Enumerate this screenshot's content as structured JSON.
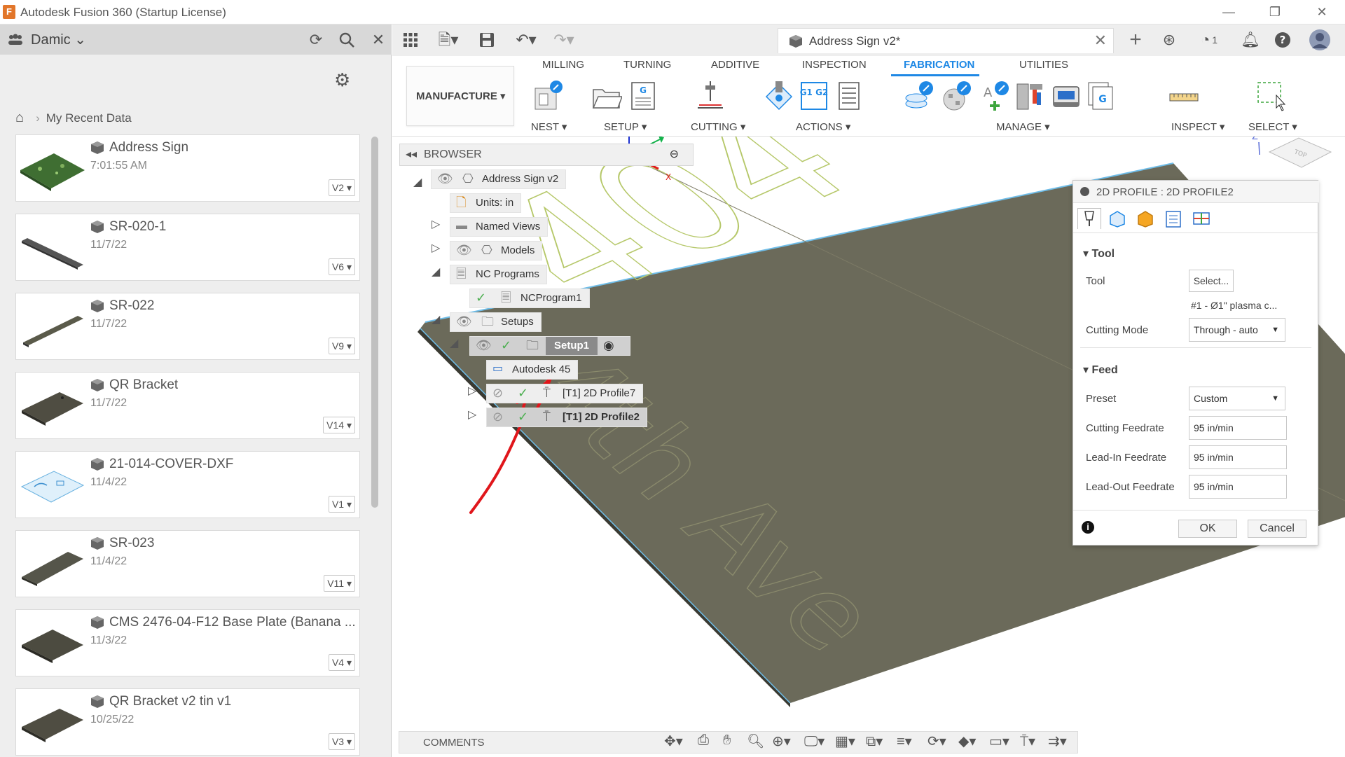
{
  "window": {
    "title": "Autodesk Fusion 360 (Startup License)",
    "controls": [
      "—",
      "❐",
      "✕"
    ]
  },
  "data_panel": {
    "team": "Damic",
    "breadcrumb": "My Recent Data",
    "items": [
      {
        "name": "Address Sign",
        "date": "7:01:55 AM",
        "version": "V2 ▾"
      },
      {
        "name": "SR-020-1",
        "date": "11/7/22",
        "version": "V6 ▾"
      },
      {
        "name": "SR-022",
        "date": "11/7/22",
        "version": "V9 ▾"
      },
      {
        "name": "QR Bracket",
        "date": "11/7/22",
        "version": "V14 ▾"
      },
      {
        "name": "21-014-COVER-DXF",
        "date": "11/4/22",
        "version": "V1 ▾"
      },
      {
        "name": "SR-023",
        "date": "11/4/22",
        "version": "V11 ▾"
      },
      {
        "name": "CMS 2476-04-F12 Base Plate (Banana ...",
        "date": "11/3/22",
        "version": "V4 ▾"
      },
      {
        "name": "QR Bracket v2 tin v1",
        "date": "10/25/22",
        "version": "V3 ▾"
      }
    ]
  },
  "document_tab": {
    "name": "Address Sign v2*",
    "notification_count": "1"
  },
  "ribbon": {
    "workspace": "MANUFACTURE ▾",
    "tabs": [
      "MILLING",
      "TURNING",
      "ADDITIVE",
      "INSPECTION",
      "FABRICATION",
      "UTILITIES"
    ],
    "active_tab": "FABRICATION",
    "groups": [
      "NEST ▾",
      "SETUP ▾",
      "CUTTING ▾",
      "ACTIONS ▾",
      "MANAGE ▾",
      "INSPECT ▾",
      "SELECT ▾"
    ],
    "nc_icon_text": "G1 G2"
  },
  "browser": {
    "title": "BROWSER",
    "nodes": {
      "root": "Address Sign v2",
      "units": "Units: in",
      "named_views": "Named Views",
      "models": "Models",
      "nc_programs": "NC Programs",
      "nc_program1": "NCProgram1",
      "setups": "Setups",
      "setup1": "Setup1",
      "machine": "Autodesk 45",
      "op1": "[T1] 2D Profile7",
      "op2": "[T1] 2D Profile2"
    }
  },
  "viewport": {
    "sign_text_1": "404",
    "sign_text_2": "4th Ave",
    "axis_y": "Y",
    "axis_x": "X",
    "axis_z": "Z",
    "viewcube_face": "TOP"
  },
  "dialog": {
    "title": "2D PROFILE : 2D PROFILE2",
    "tool_section": "Tool",
    "tool_label": "Tool",
    "tool_button": "Select...",
    "tool_desc": "#1 - Ø1\" plasma c...",
    "cutting_mode_label": "Cutting Mode",
    "cutting_mode_value": "Through - auto",
    "feed_section": "Feed",
    "preset_label": "Preset",
    "preset_value": "Custom",
    "cutting_feed_label": "Cutting Feedrate",
    "cutting_feed_value": "95 in/min",
    "leadin_label": "Lead-In Feedrate",
    "leadin_value": "95 in/min",
    "leadout_label": "Lead-Out Feedrate",
    "leadout_value": "95 in/min",
    "ok": "OK",
    "cancel": "Cancel"
  },
  "comments": {
    "label": "COMMENTS"
  },
  "colors": {
    "accent": "#1e88e5",
    "plate": "#6b6a5a",
    "contour": "#b6c86a",
    "annotation": "#e0161b"
  }
}
